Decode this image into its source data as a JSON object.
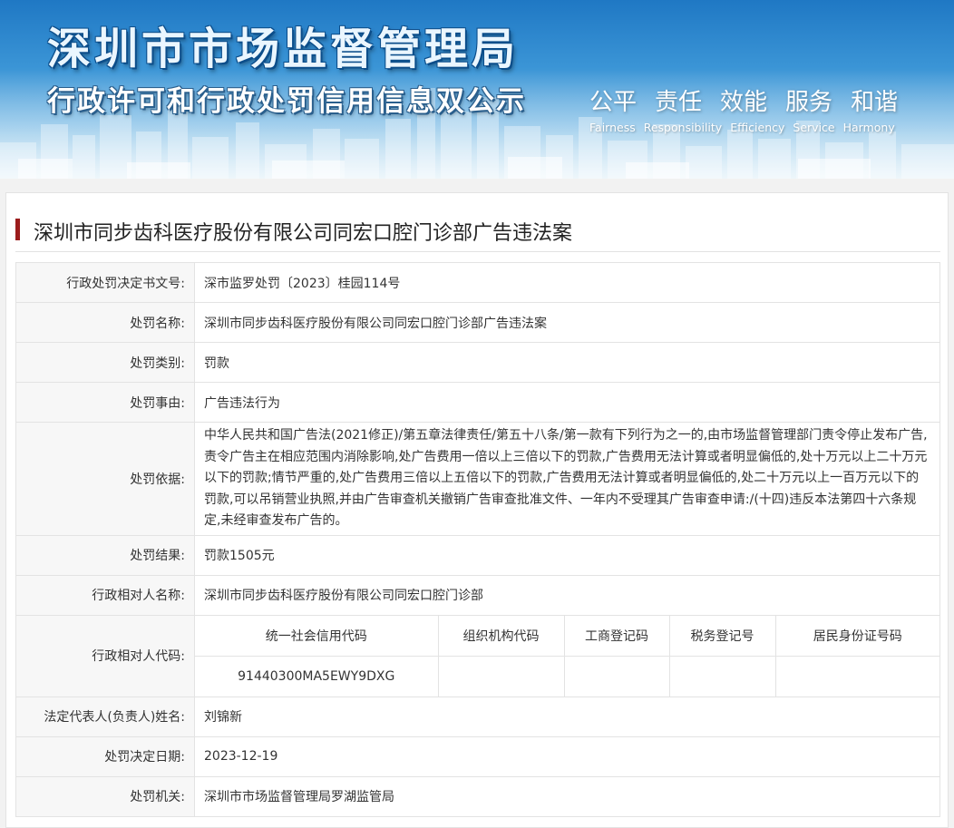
{
  "header": {
    "title": "深圳市市场监督管理局",
    "subtitle": "行政许可和行政处罚信用信息双公示",
    "slogan_cn": [
      "公平",
      "责任",
      "效能",
      "服务",
      "和谐"
    ],
    "slogan_en": [
      "Fairness",
      "Responsibility",
      "Efficiency",
      "Service",
      "Harmony"
    ]
  },
  "case_title": "深圳市同步齿科医疗股份有限公司同宏口腔门诊部广告违法案",
  "colors": {
    "title_bar": "#9b1c1c",
    "label_bg": "#f7f7f7",
    "border": "#e3e3e3"
  },
  "rows": {
    "decision_no": {
      "label": "行政处罚决定书文号:",
      "value": "深市监罗处罚〔2023〕桂园114号"
    },
    "penalty_name": {
      "label": "处罚名称:",
      "value": "深圳市同步齿科医疗股份有限公司同宏口腔门诊部广告违法案"
    },
    "penalty_type": {
      "label": "处罚类别:",
      "value": "罚款"
    },
    "penalty_reason": {
      "label": "处罚事由:",
      "value": "广告违法行为"
    },
    "penalty_basis": {
      "label": "处罚依据:",
      "value": "中华人民共和国广告法(2021修正)/第五章法律责任/第五十八条/第一款有下列行为之一的,由市场监督管理部门责令停止发布广告,责令广告主在相应范围内消除影响,处广告费用一倍以上三倍以下的罚款,广告费用无法计算或者明显偏低的,处十万元以上二十万元以下的罚款;情节严重的,处广告费用三倍以上五倍以下的罚款,广告费用无法计算或者明显偏低的,处二十万元以上一百万元以下的罚款,可以吊销营业执照,并由广告审查机关撤销广告审查批准文件、一年内不受理其广告审查申请:/(十四)违反本法第四十六条规定,未经审查发布广告的。"
    },
    "penalty_result": {
      "label": "处罚结果:",
      "value": "罚款1505元"
    },
    "party_name": {
      "label": "行政相对人名称:",
      "value": "深圳市同步齿科医疗股份有限公司同宏口腔门诊部"
    },
    "party_code": {
      "label": "行政相对人代码:",
      "headers": [
        "统一社会信用代码",
        "组织机构代码",
        "工商登记码",
        "税务登记号",
        "居民身份证号码"
      ],
      "values": [
        "91440300MA5EWY9DXG",
        "",
        "",
        "",
        ""
      ]
    },
    "legal_rep": {
      "label": "法定代表人(负责人)姓名:",
      "value": "刘锦新"
    },
    "decision_date": {
      "label": "处罚决定日期:",
      "value": "2023-12-19"
    },
    "authority": {
      "label": "处罚机关:",
      "value": "深圳市市场监督管理局罗湖监管局"
    }
  }
}
